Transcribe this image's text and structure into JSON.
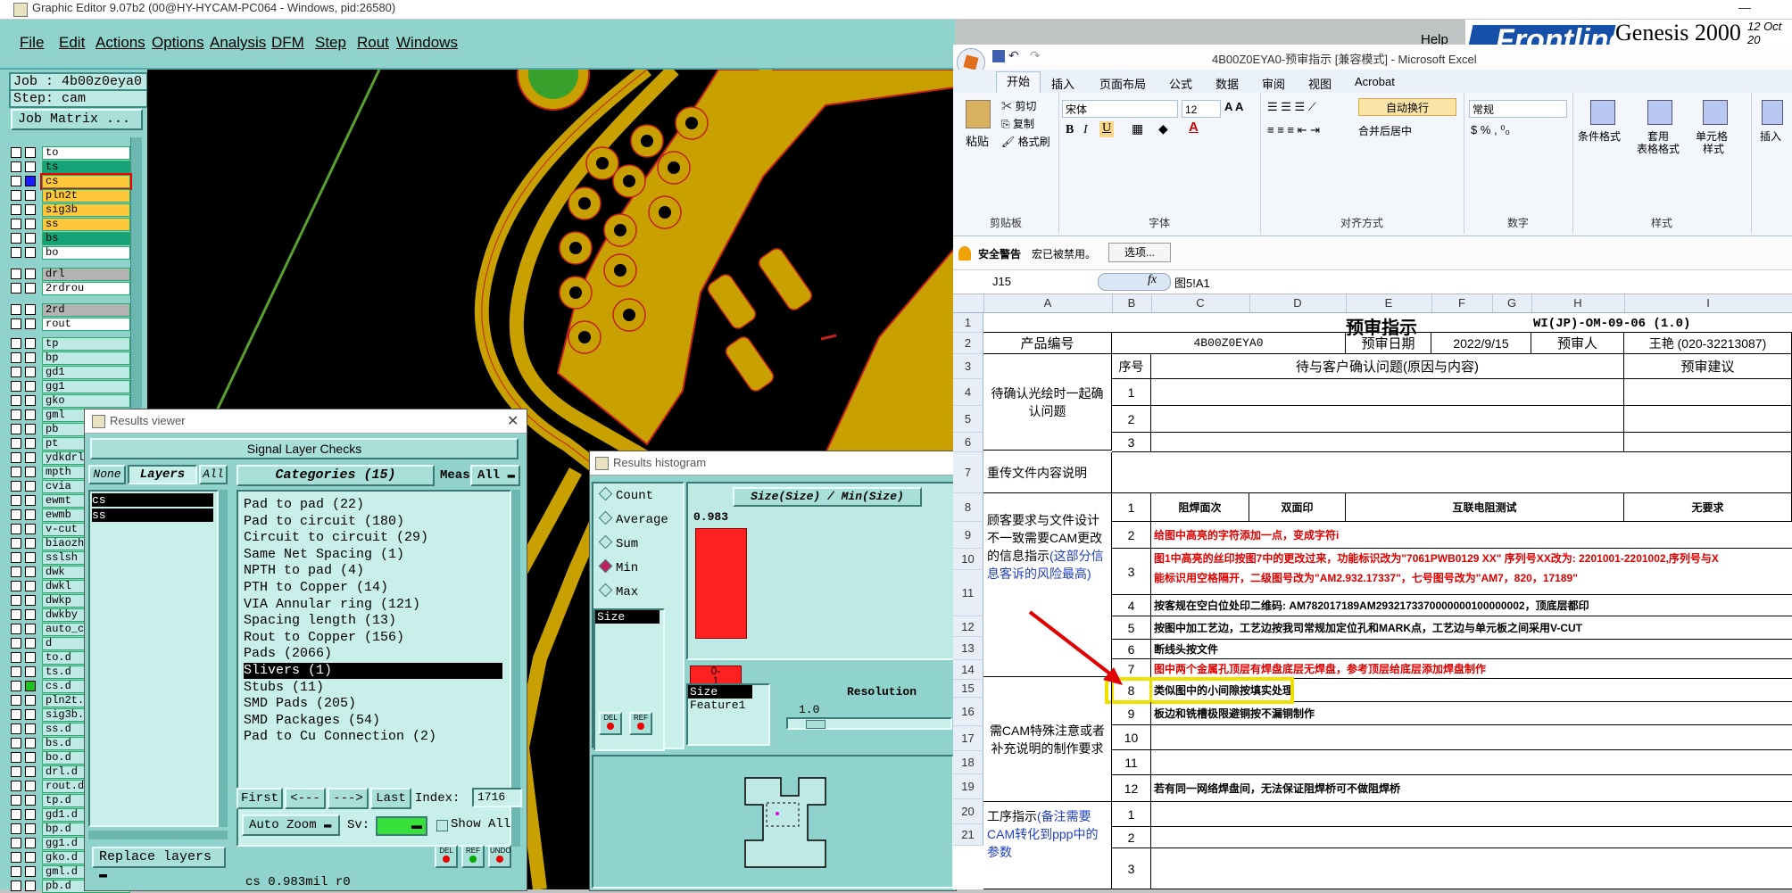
{
  "window": {
    "title": "Graphic Editor 9.07b2 (00@HY-HYCAM-PC064 - Windows, pid:26580)"
  },
  "menu": [
    "File",
    "Edit",
    "Actions",
    "Options",
    "Analysis",
    "DFM",
    "Step",
    "Rout",
    "Windows"
  ],
  "help": "Help",
  "logo": {
    "brand": "Frontline",
    "product": "Genesis 2000",
    "date_line": "12 Oct 20"
  },
  "job": {
    "job": "Job : 4b00z0eya0",
    "step": "Step: cam",
    "matrix": "Job Matrix ..."
  },
  "layers": [
    "to",
    "ts",
    "cs",
    "pln2t",
    "sig3b",
    "ss",
    "bs",
    "bo",
    "drl",
    "2rdrou",
    "2rd",
    "rout",
    "tp",
    "bp",
    "gd1",
    "gg1",
    "gko",
    "gml",
    "pb",
    "pt",
    "ydkdrl",
    "mpth",
    "cvia",
    "ewmt",
    "ewmb",
    "v-cut",
    "biaozh",
    "sslsh",
    "dwk",
    "dwkl",
    "dwkp",
    "dwkby",
    "auto_c",
    "d",
    "to.d",
    "ts.d",
    "cs.d",
    "pln2t.",
    "sig3b.",
    "ss.d",
    "bs.d",
    "bo.d",
    "drl.d",
    "rout.d",
    "tp.d",
    "gd1.d",
    "bp.d",
    "gg1.d",
    "gko.d",
    "gml.d",
    "pb.d"
  ],
  "layer_colors": {
    "to": "#ffffff",
    "ts": "#14a276",
    "cs": "#ffc83c",
    "pln2t": "#ffc83c",
    "sig3b": "#ffc83c",
    "ss": "#ffc83c",
    "bs": "#14a276",
    "bo": "#ffffff",
    "drl": "#b4b4b4",
    "2rdrou": "#ffffff",
    "2rd": "#b4b4b4",
    "rout": "#ffffff",
    "default": "#bfe9e4"
  },
  "results_viewer": {
    "title": "Results viewer",
    "section": "Signal Layer Checks",
    "tabs": [
      "None",
      "Layers",
      "All"
    ],
    "categories_label": "Categories (15)",
    "meas_label": "Meas:",
    "meas_value": "All",
    "layers_list": [
      "cs",
      "ss"
    ],
    "categories": [
      "Pad to pad (22)",
      "Pad to circuit (180)",
      "Circuit to circuit (29)",
      "Same Net Spacing (1)",
      "NPTH to pad (4)",
      "PTH to Copper (14)",
      "VIA Annular ring (121)",
      "Spacing length (13)",
      "Rout to Copper (156)",
      "Pads (2066)",
      "Slivers (1)",
      "Stubs (11)",
      "SMD Pads (205)",
      "SMD Packages (54)",
      "Pad to Cu Connection (2)"
    ],
    "selected_category": "Slivers (1)",
    "nav": [
      "First",
      "<---",
      "--->",
      "Last"
    ],
    "index_label": "Index:",
    "index_value": "1716",
    "zoom": "Auto Zoom",
    "sv_label": "Sv:",
    "show_all": "Show All",
    "replace": "Replace layers",
    "status": "cs 0.983mil  r0",
    "btn_del": "DEL",
    "btn_ref": "REF",
    "btn_undo": "UNDO"
  },
  "results_histogram": {
    "title": "Results histogram",
    "options": [
      "Count",
      "Average",
      "Sum",
      "Min",
      "Max"
    ],
    "selected": "Min",
    "chart_title": "Size(Size) / Min(Size)",
    "bar_value": "0.983",
    "x_label_1": "0-",
    "x_label_2": "1",
    "list_item": "Size",
    "sel_list": [
      "Size",
      "Feature1"
    ],
    "resolution_label": "Resolution",
    "resolution_value": "1.0",
    "btn_del": "DEL",
    "btn_ref": "REF"
  },
  "excel": {
    "title": "4B00Z0EYA0-预审指示 [兼容模式] - Microsoft Excel",
    "tabs": [
      "开始",
      "插入",
      "页面布局",
      "公式",
      "数据",
      "审阅",
      "视图",
      "Acrobat"
    ],
    "ribbon": {
      "paste": "粘贴",
      "cut": "剪切",
      "copy": "复制",
      "format_painter": "格式刷",
      "clipboard": "剪贴板",
      "font_name": "宋体",
      "font_size": "12",
      "font": "字体",
      "wrap": "自动换行",
      "merge": "合并后居中",
      "align": "对齐方式",
      "number_format": "常规",
      "number": "数字",
      "cond_format": "条件格式",
      "table_format_1": "套用",
      "table_format_2": "表格格式",
      "cell_style_1": "单元格",
      "cell_style_2": "样式",
      "styles": "样式",
      "insert": "插入"
    },
    "security": {
      "label": "安全警告",
      "msg": "宏已被禁用。",
      "options": "选项..."
    },
    "name_box": "J15",
    "formula": "图5!A1",
    "columns": [
      "A",
      "B",
      "C",
      "D",
      "E",
      "F",
      "G",
      "H",
      "I"
    ],
    "sheet": {
      "title": "预审指示",
      "doc_no": "WI(JP)-OM-09-06 (1.0)",
      "product_label": "产品编号",
      "product_value": "4B00Z0EYA0",
      "date_label": "预审日期",
      "date_value": "2022/9/15",
      "person_label": "预审人",
      "person_value": "王艳 (020-32213087)",
      "seq_label": "序号",
      "issue_header": "待与客户确认问题(原因与内容)",
      "suggest_header": "预审建议",
      "sec1": "待确认光绘时一起确认问题",
      "sec2": "重传文件内容说明",
      "sec3a": "顾客要求与文件设计不一致需要CAM更改的信息指示",
      "sec3b": "(这部分信息客诉的风险最高)",
      "sec4": "需CAM特殊注意或者补充说明的制作要求",
      "sec5a": "工序指示",
      "sec5b": "(备注需要CAM转化到ppp中的参数",
      "row8": [
        "阻焊面次",
        "双面印",
        "互联电阻测试",
        "无要求"
      ],
      "items": [
        {
          "n": "2",
          "t": "给图中高亮的字符添加一点，变成字符i",
          "c": "red"
        },
        {
          "n": "3",
          "t": "图1中高亮的丝印按图7中的更改过来，功能标识改为\"7061PWB0129 XX\" 序列号XX改为: 2201001-2201002,序列号与X",
          "t2": "能标识用空格隔开，二级图号改为\"AM2.932.17337\"，七号图号改为\"AM7，820，17189\"",
          "c": "red"
        },
        {
          "n": "4",
          "t": "按客规在空白位处印二维码: AM782017189AM2932173370000000100000002，顶底层都印",
          "c": "blk"
        },
        {
          "n": "5",
          "t": "按图中加工艺边，工艺边按我司常规加定位孔和MARK点，工艺边与单元板之间采用V-CUT",
          "c": "blk"
        },
        {
          "n": "6",
          "t": "断线头按文件",
          "c": "blk"
        },
        {
          "n": "7",
          "t": "图中两个金属孔顶层有焊盘底层无焊盘，参考顶层给底层添加焊盘制作",
          "c": "red"
        },
        {
          "n": "8",
          "t": "类似图中的小间隙按填实处理",
          "c": "blk"
        },
        {
          "n": "9",
          "t": "板边和铣槽极限避铜按不漏铜制作",
          "c": "blk"
        },
        {
          "n": "10",
          "t": "",
          "c": "blk"
        },
        {
          "n": "11",
          "t": "",
          "c": "blk"
        },
        {
          "n": "12",
          "t": "若有同一网络焊盘间，无法保证阻焊桥可不做阻焊桥",
          "c": "blk"
        }
      ],
      "blank_rows": [
        "1",
        "2",
        "3"
      ]
    },
    "row_numbers": [
      "1",
      "2",
      "3",
      "4",
      "5",
      "6",
      "7",
      "8",
      "9",
      "10",
      "11",
      "12",
      "13",
      "14",
      "15",
      "16",
      "17",
      "18",
      "19",
      "20",
      "21"
    ]
  }
}
